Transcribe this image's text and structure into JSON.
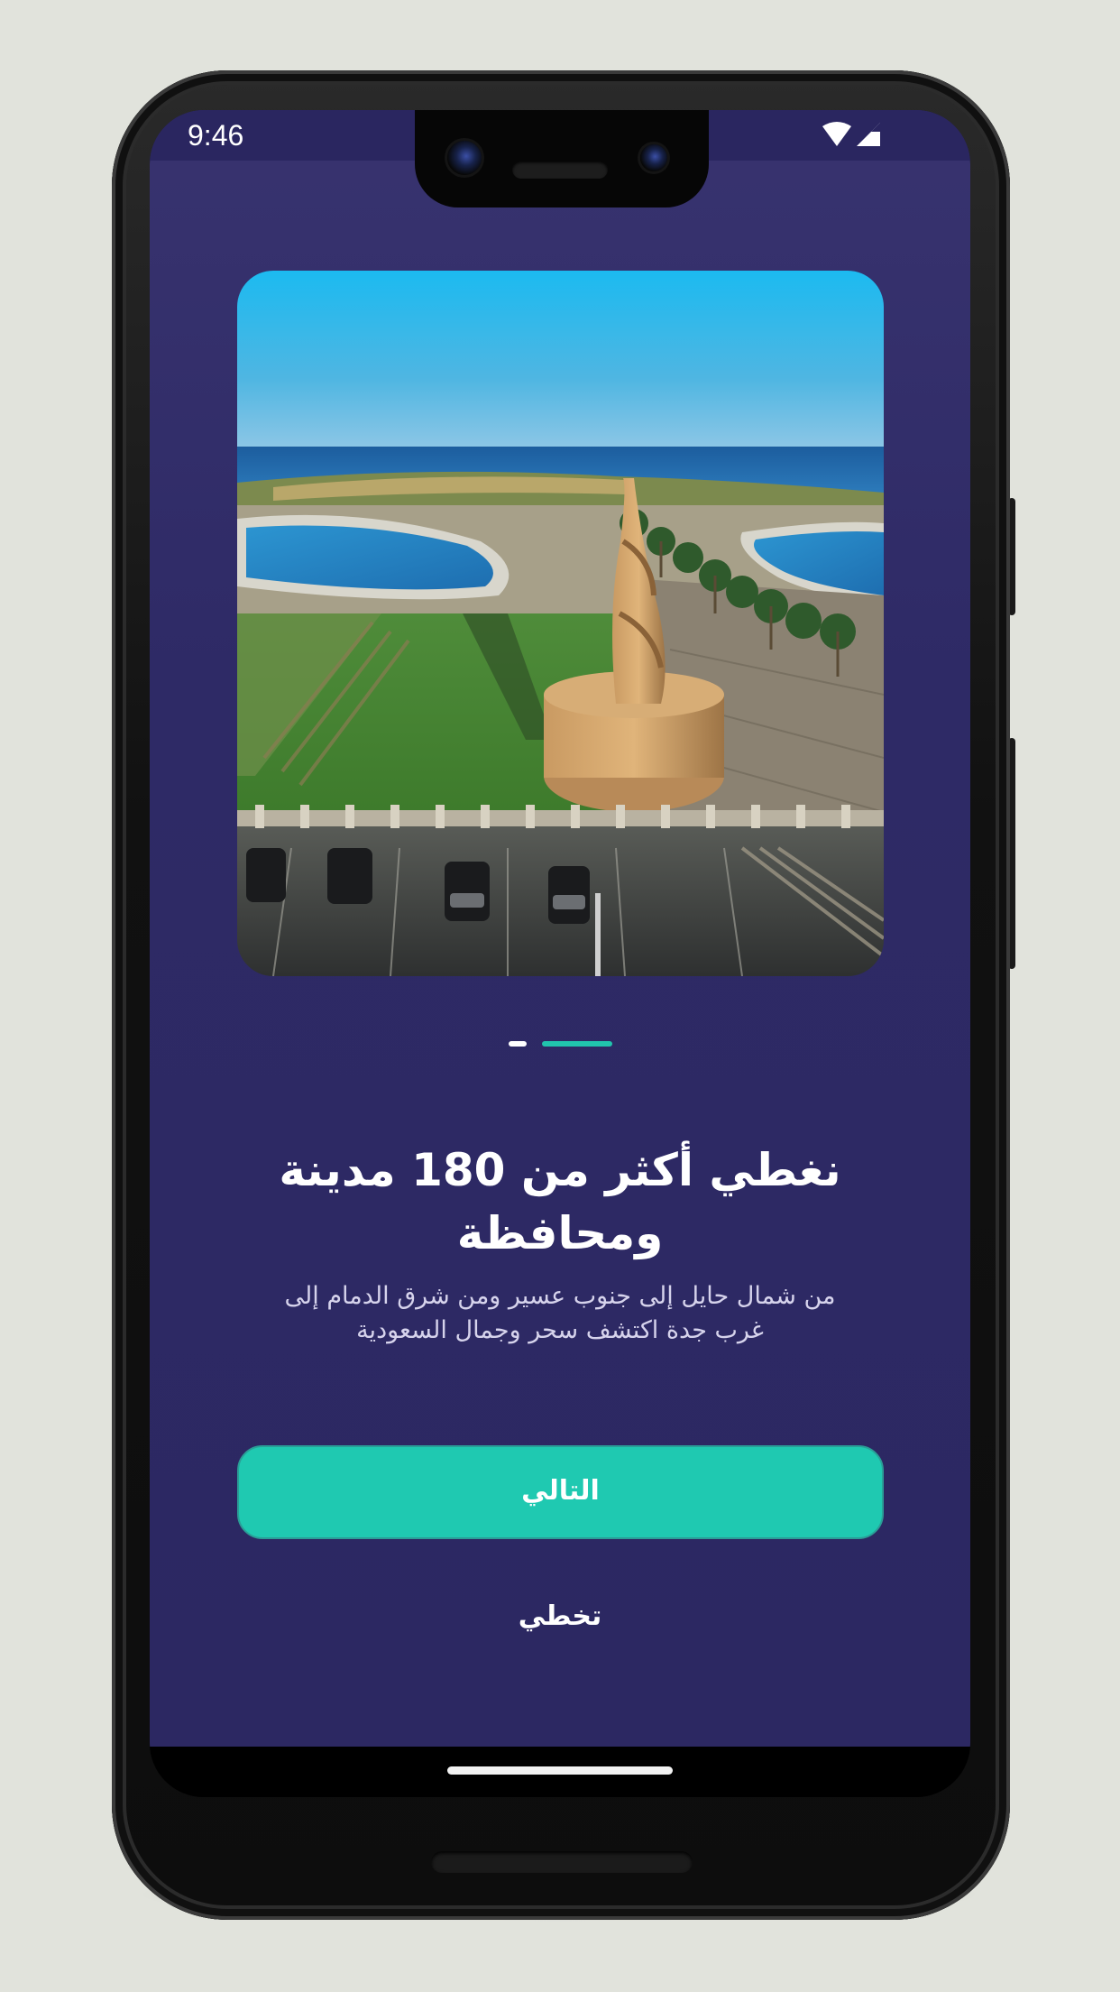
{
  "status_bar": {
    "time": "9:46",
    "icons": [
      "wifi-icon",
      "cellular-signal-icon"
    ]
  },
  "onboarding": {
    "hero_image": "seaside corniche park with spiral tower monument",
    "pager": {
      "pages": 2,
      "current": 2
    },
    "title": "نغطي أكثر من 180 مدينة ومحافظة",
    "subtitle": "من شمال حايل إلى جنوب عسير ومن شرق الدمام إلى غرب جدة اكتشف سحر وجمال السعودية",
    "next_button": "التالي",
    "skip_button": "تخطي"
  },
  "colors": {
    "background": "#2e2a66",
    "accent": "#1fc9b1",
    "text": "#ffffff"
  }
}
